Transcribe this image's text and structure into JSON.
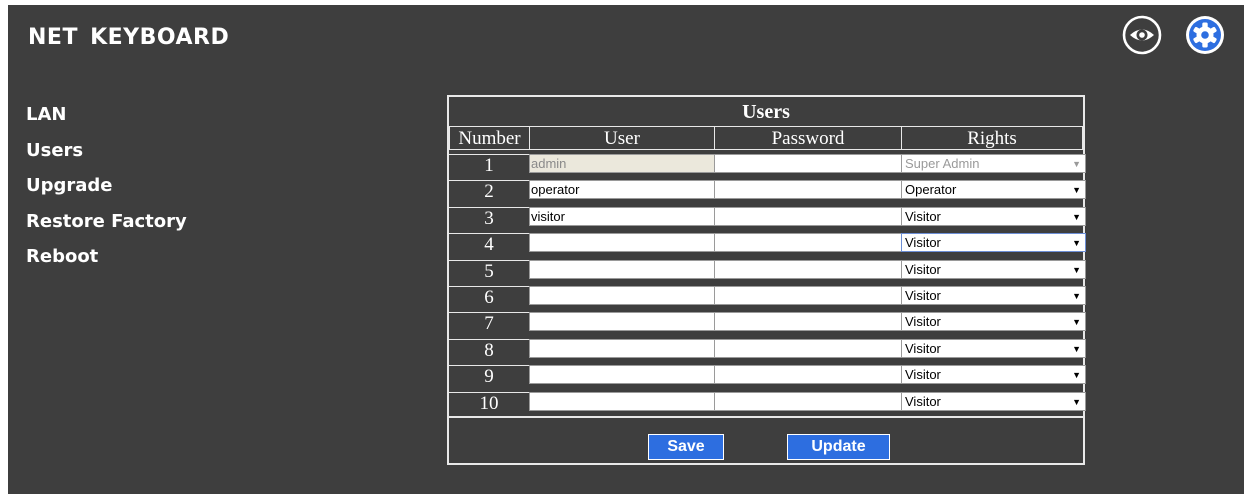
{
  "header": {
    "title": "NET  KEYBOARD",
    "icons": [
      "eye-icon",
      "gear-icon"
    ]
  },
  "sidebar": {
    "items": [
      {
        "label": "LAN"
      },
      {
        "label": "Users"
      },
      {
        "label": "Upgrade"
      },
      {
        "label": "Restore Factory"
      },
      {
        "label": "Reboot"
      }
    ]
  },
  "users_table": {
    "title": "Users",
    "columns": [
      "Number",
      "User",
      "Password",
      "Rights"
    ],
    "rows": [
      {
        "number": "1",
        "user": "admin",
        "password": "",
        "rights": "Super Admin",
        "disabled": true
      },
      {
        "number": "2",
        "user": "operator",
        "password": "",
        "rights": "Operator"
      },
      {
        "number": "3",
        "user": "visitor",
        "password": "",
        "rights": "Visitor"
      },
      {
        "number": "4",
        "user": "",
        "password": "",
        "rights": "Visitor",
        "focused": true
      },
      {
        "number": "5",
        "user": "",
        "password": "",
        "rights": "Visitor"
      },
      {
        "number": "6",
        "user": "",
        "password": "",
        "rights": "Visitor"
      },
      {
        "number": "7",
        "user": "",
        "password": "",
        "rights": "Visitor"
      },
      {
        "number": "8",
        "user": "",
        "password": "",
        "rights": "Visitor"
      },
      {
        "number": "9",
        "user": "",
        "password": "",
        "rights": "Visitor"
      },
      {
        "number": "10",
        "user": "",
        "password": "",
        "rights": "Visitor"
      }
    ],
    "rights_options": [
      "Super Admin",
      "Operator",
      "Visitor"
    ],
    "buttons": {
      "save": "Save",
      "update": "Update"
    }
  },
  "colors": {
    "background": "#3e3e3e",
    "accent": "#2d6ee0",
    "text": "#ffffff"
  }
}
